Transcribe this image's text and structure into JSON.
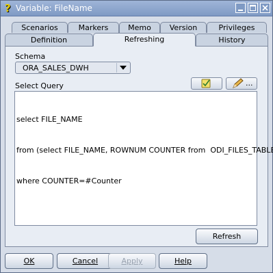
{
  "window": {
    "title": "Variable: FileName"
  },
  "tabs_back": [
    "Scenarios",
    "Markers",
    "Memo",
    "Version",
    "Privileges"
  ],
  "tabs_front": [
    "Definition",
    "Refreshing",
    "History"
  ],
  "active_tab": "Refreshing",
  "schema": {
    "label": "Schema",
    "value": "ORA_SALES_DWH"
  },
  "query": {
    "label": "Select Query",
    "lines": [
      "select FILE_NAME",
      "from (select FILE_NAME, ROWNUM COUNTER from  ODI_FILES_TABLE)",
      "where COUNTER=#Counter"
    ],
    "expression_button_label": "..."
  },
  "refresh_button": "Refresh",
  "footer": {
    "ok": "OK",
    "cancel": "Cancel",
    "apply": "Apply",
    "help": "Help"
  },
  "icons": [
    "help-icon",
    "minimize-icon",
    "maximize-icon",
    "close-icon",
    "check-syntax-icon",
    "pencil-icon",
    "dropdown-arrow-icon"
  ]
}
